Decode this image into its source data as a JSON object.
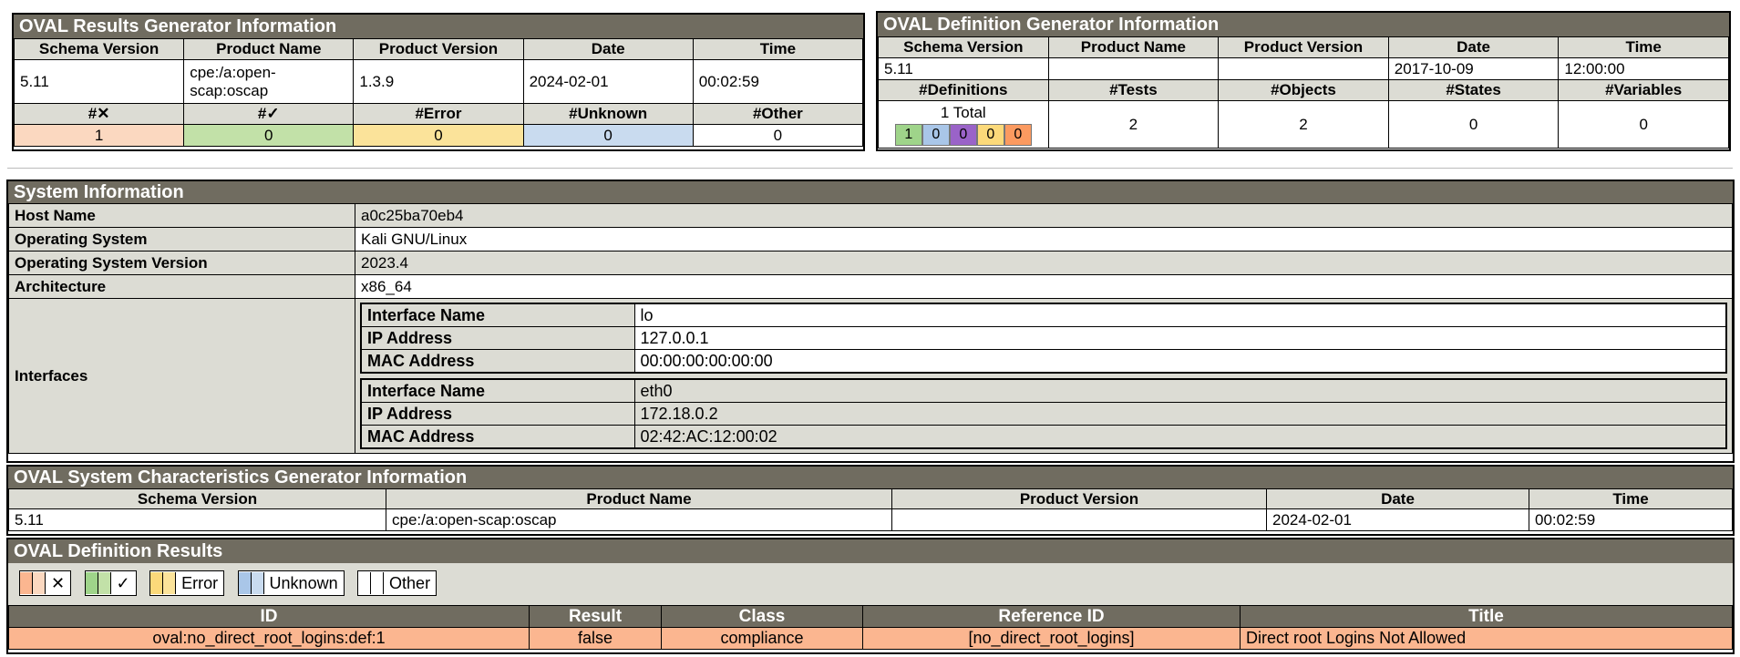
{
  "results_gen": {
    "title": "OVAL Results Generator Information",
    "headers": [
      "Schema Version",
      "Product Name",
      "Product Version",
      "Date",
      "Time"
    ],
    "values": [
      "5.11",
      "cpe:/a:open-scap:oscap",
      "1.3.9",
      "2024-02-01",
      "00:02:59"
    ],
    "count_headers": [
      "#✕",
      "#✓",
      "#Error",
      "#Unknown",
      "#Other"
    ],
    "counts": [
      "1",
      "0",
      "0",
      "0",
      "0"
    ]
  },
  "def_gen": {
    "title": "OVAL Definition Generator Information",
    "headers": [
      "Schema Version",
      "Product Name",
      "Product Version",
      "Date",
      "Time"
    ],
    "values": [
      "5.11",
      "",
      "",
      "2017-10-09",
      "12:00:00"
    ],
    "count_headers": [
      "#Definitions",
      "#Tests",
      "#Objects",
      "#States",
      "#Variables"
    ],
    "total_label": "1 Total",
    "total_breakdown": [
      "1",
      "0",
      "0",
      "0",
      "0"
    ],
    "counts": [
      "2",
      "2",
      "0",
      "0"
    ]
  },
  "sysinfo": {
    "title": "System Information",
    "rows": [
      {
        "label": "Host Name",
        "value": "a0c25ba70eb4"
      },
      {
        "label": "Operating System",
        "value": "Kali GNU/Linux"
      },
      {
        "label": "Operating System Version",
        "value": "2023.4"
      },
      {
        "label": "Architecture",
        "value": "x86_64"
      }
    ],
    "interfaces_label": "Interfaces",
    "interfaces": [
      {
        "rows": [
          {
            "label": "Interface Name",
            "value": "lo"
          },
          {
            "label": "IP Address",
            "value": "127.0.0.1"
          },
          {
            "label": "MAC Address",
            "value": "00:00:00:00:00:00"
          }
        ]
      },
      {
        "rows": [
          {
            "label": "Interface Name",
            "value": "eth0"
          },
          {
            "label": "IP Address",
            "value": "172.18.0.2"
          },
          {
            "label": "MAC Address",
            "value": "02:42:AC:12:00:02"
          }
        ]
      }
    ]
  },
  "sc_gen": {
    "title": "OVAL System Characteristics Generator Information",
    "headers": [
      "Schema Version",
      "Product Name",
      "Product Version",
      "Date",
      "Time"
    ],
    "values": [
      "5.11",
      "cpe:/a:open-scap:oscap",
      "",
      "2024-02-01",
      "00:02:59"
    ]
  },
  "def_results": {
    "title": "OVAL Definition Results",
    "legend": [
      {
        "label": "✕",
        "color": "#fbb690"
      },
      {
        "label": "✓",
        "color": "#9fd48a"
      },
      {
        "label": "Error",
        "color": "#fbd97a"
      },
      {
        "label": "Unknown",
        "color": "#a9c6e8"
      },
      {
        "label": "Other",
        "color": "#ffffff"
      }
    ],
    "headers": [
      "ID",
      "Result",
      "Class",
      "Reference ID",
      "Title"
    ],
    "rows": [
      [
        "oval:no_direct_root_logins:def:1",
        "false",
        "compliance",
        "[no_direct_root_logins]",
        "Direct root Logins Not Allowed"
      ]
    ]
  },
  "colors": {
    "title_bg": "#706c60",
    "header_bg": "#dcdcd4",
    "fail_row": "#fbb690",
    "total_breakdown": [
      "#9fd48a",
      "#a9c6e8",
      "#9a63c8",
      "#fbd97a",
      "#fb9a60"
    ]
  }
}
